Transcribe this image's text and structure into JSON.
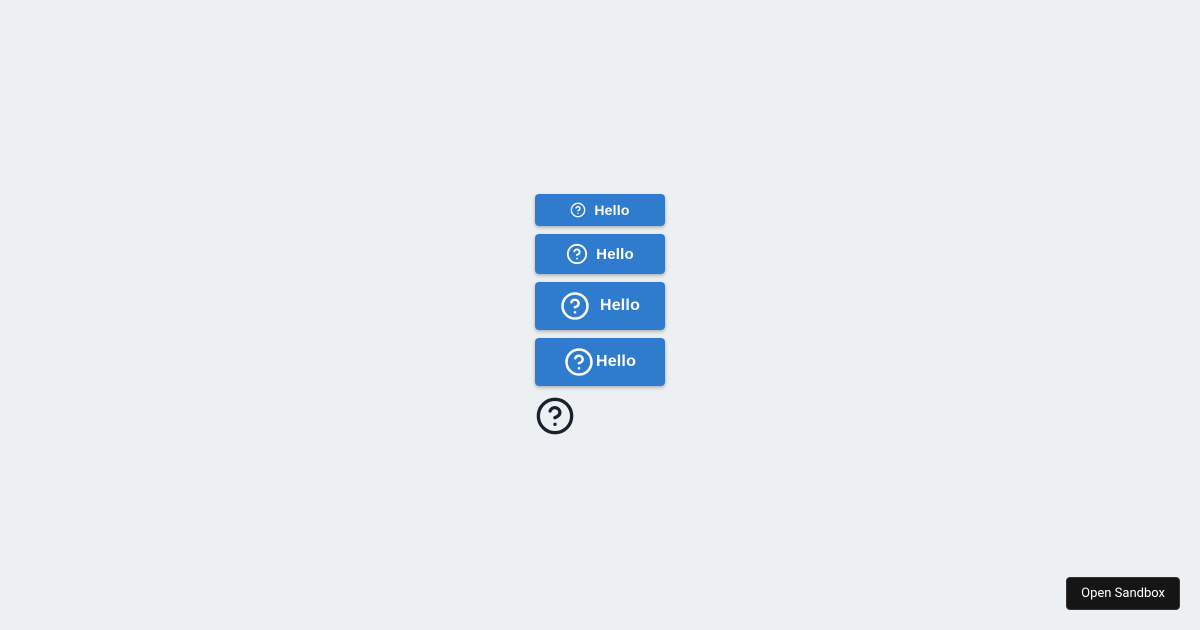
{
  "buttons": [
    {
      "label": "Hello"
    },
    {
      "label": "Hello"
    },
    {
      "label": "Hello"
    },
    {
      "label": "Hello"
    }
  ],
  "footer": {
    "open_sandbox": "Open Sandbox"
  },
  "colors": {
    "button_bg": "#2f7bce",
    "page_bg": "#ecf0f3",
    "icon_dark": "#1a202c"
  }
}
